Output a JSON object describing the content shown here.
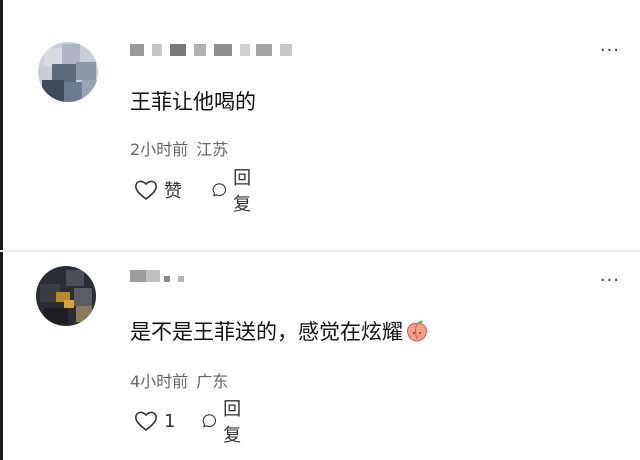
{
  "comments": [
    {
      "text": "王菲让他喝的",
      "time": "2小时前",
      "location": "江苏",
      "like_label": "赞",
      "reply_label": "回复",
      "more_label": "···"
    },
    {
      "text": "是不是王菲送的，感觉在炫耀",
      "time": "4小时前",
      "location": "广东",
      "like_count": "1",
      "reply_label": "回复",
      "more_label": "···"
    }
  ],
  "icons": {
    "like": "heart-outline-icon",
    "reply": "speech-bubble-icon",
    "more": "ellipsis-icon",
    "emoji": "peach-emoji-icon"
  },
  "colors": {
    "text": "#111111",
    "meta": "#666666",
    "divider": "#ececec"
  }
}
